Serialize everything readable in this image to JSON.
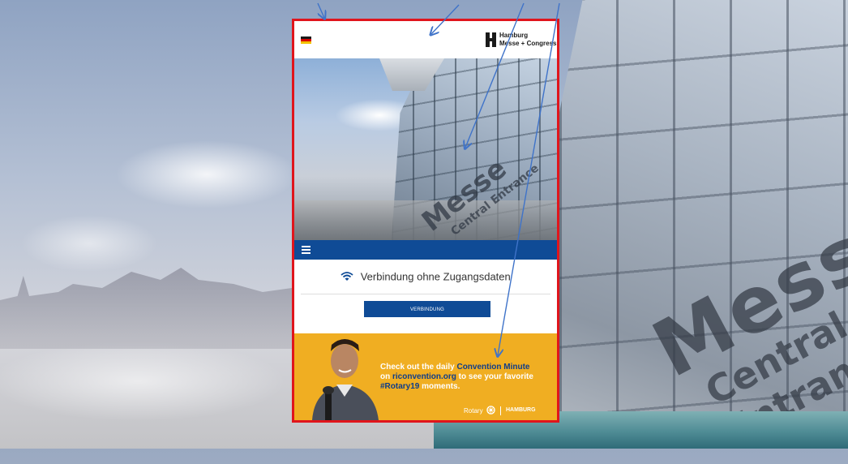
{
  "app": {
    "logo_line1": "Hamburg",
    "logo_line2": "Messe + Congress"
  },
  "background": {
    "sign_text": "Messe",
    "entrance_text": "Central Entrance"
  },
  "hero": {
    "sign_text": "Messe",
    "entrance_text": "Central Entrance"
  },
  "wifi": {
    "label": "Verbindung ohne Zugangsdaten"
  },
  "connect_button": {
    "label": "VERBINDUNG"
  },
  "banner": {
    "line1_prefix": "Check out the daily ",
    "line1_highlight": "Convention Minute",
    "line2_prefix": "on ",
    "line2_highlight": "riconvention.org",
    "line2_suffix": " to see your favorite",
    "line3_highlight": "#Rotary19",
    "line3_suffix": " moments.",
    "footer_rotary": "Rotary",
    "footer_hamburg": "HAMBURG"
  },
  "colors": {
    "frame_border": "#e0151c",
    "brand_blue": "#0f4b96",
    "banner_yellow": "#f0ae22",
    "arrow_blue": "#3f73c9"
  },
  "icons": [
    "flag-germany-icon",
    "hamburg-messe-logo-icon",
    "hamburger-menu-icon",
    "wifi-icon",
    "rotary-wheel-icon"
  ]
}
